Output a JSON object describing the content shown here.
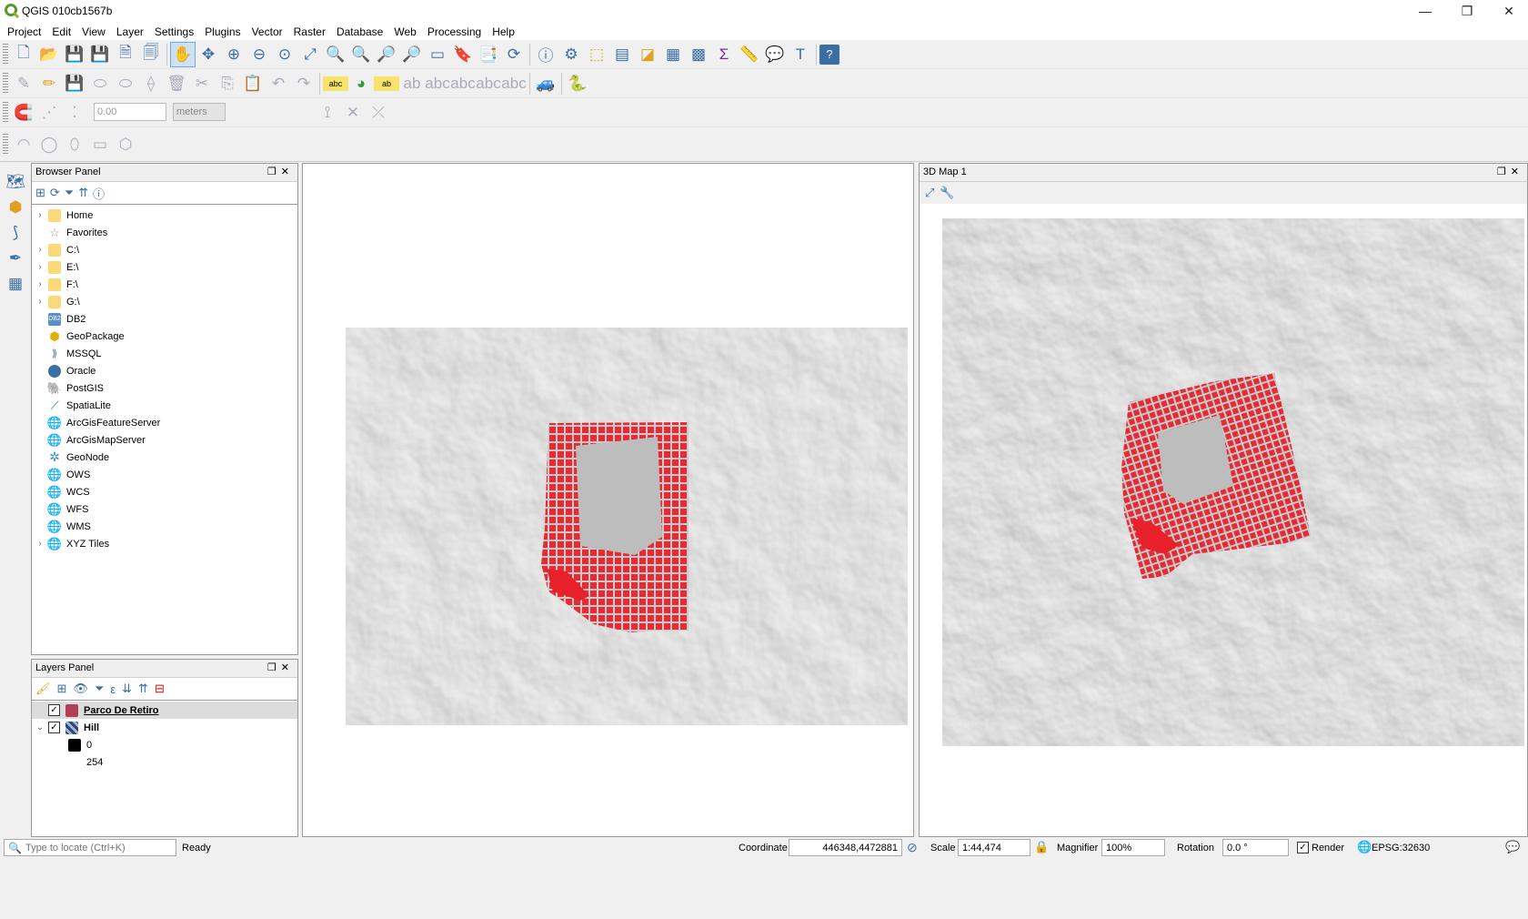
{
  "window": {
    "title": "QGIS 010cb1567b",
    "controls": {
      "minimize": "—",
      "restore": "❐",
      "close": "✕"
    }
  },
  "menu": [
    "Project",
    "Edit",
    "View",
    "Layer",
    "Settings",
    "Plugins",
    "Vector",
    "Raster",
    "Database",
    "Web",
    "Processing",
    "Help"
  ],
  "toolbar": {
    "digitize_value": "0.00",
    "units": "meters"
  },
  "browser": {
    "title": "Browser Panel",
    "items": [
      {
        "label": "Home",
        "icon": "folder-icon",
        "expand": true
      },
      {
        "label": "Favorites",
        "icon": "star-icon",
        "expand": false
      },
      {
        "label": "C:\\",
        "icon": "folder-icon",
        "expand": true
      },
      {
        "label": "E:\\",
        "icon": "folder-icon",
        "expand": true
      },
      {
        "label": "F:\\",
        "icon": "folder-icon",
        "expand": true
      },
      {
        "label": "G:\\",
        "icon": "folder-icon",
        "expand": true
      },
      {
        "label": "DB2",
        "icon": "db2-icon",
        "expand": false
      },
      {
        "label": "GeoPackage",
        "icon": "geopackage-icon",
        "expand": false
      },
      {
        "label": "MSSQL",
        "icon": "mssql-icon",
        "expand": false
      },
      {
        "label": "Oracle",
        "icon": "oracle-icon",
        "expand": false
      },
      {
        "label": "PostGIS",
        "icon": "postgis-icon",
        "expand": false
      },
      {
        "label": "SpatiaLite",
        "icon": "spatialite-icon",
        "expand": false
      },
      {
        "label": "ArcGisFeatureServer",
        "icon": "globe-icon",
        "expand": false
      },
      {
        "label": "ArcGisMapServer",
        "icon": "globe-icon",
        "expand": false
      },
      {
        "label": "GeoNode",
        "icon": "geonode-icon",
        "expand": false
      },
      {
        "label": "OWS",
        "icon": "ows-icon",
        "expand": false
      },
      {
        "label": "WCS",
        "icon": "globe-icon",
        "expand": false
      },
      {
        "label": "WFS",
        "icon": "globe-icon",
        "expand": false
      },
      {
        "label": "WMS",
        "icon": "globe-icon",
        "expand": false
      },
      {
        "label": "XYZ Tiles",
        "icon": "globe-icon",
        "expand": true
      }
    ]
  },
  "layers": {
    "title": "Layers Panel",
    "items": [
      {
        "label": "Parco De Retiro",
        "checked": true,
        "swatch": "#b0405a"
      },
      {
        "label": "Hill",
        "checked": true,
        "expanded": true
      },
      {
        "label": "0",
        "legend": true,
        "swatch": "#000000"
      },
      {
        "label": "254",
        "legend": true
      }
    ]
  },
  "map3d": {
    "title": "3D Map 1"
  },
  "status": {
    "locate_placeholder": "Type to locate (Ctrl+K)",
    "ready": "Ready",
    "coordinate_label": "Coordinate",
    "coordinate": "446348,4472881",
    "scale_label": "Scale",
    "scale": "1:44,474",
    "magnifier_label": "Magnifier",
    "magnifier": "100%",
    "rotation_label": "Rotation",
    "rotation": "0.0 °",
    "render_label": "Render",
    "crs": "EPSG:32630"
  },
  "colors": {
    "accent": "#3b6ea5",
    "buildings": "#e8202a",
    "hillshade": "#b5b5b5"
  }
}
